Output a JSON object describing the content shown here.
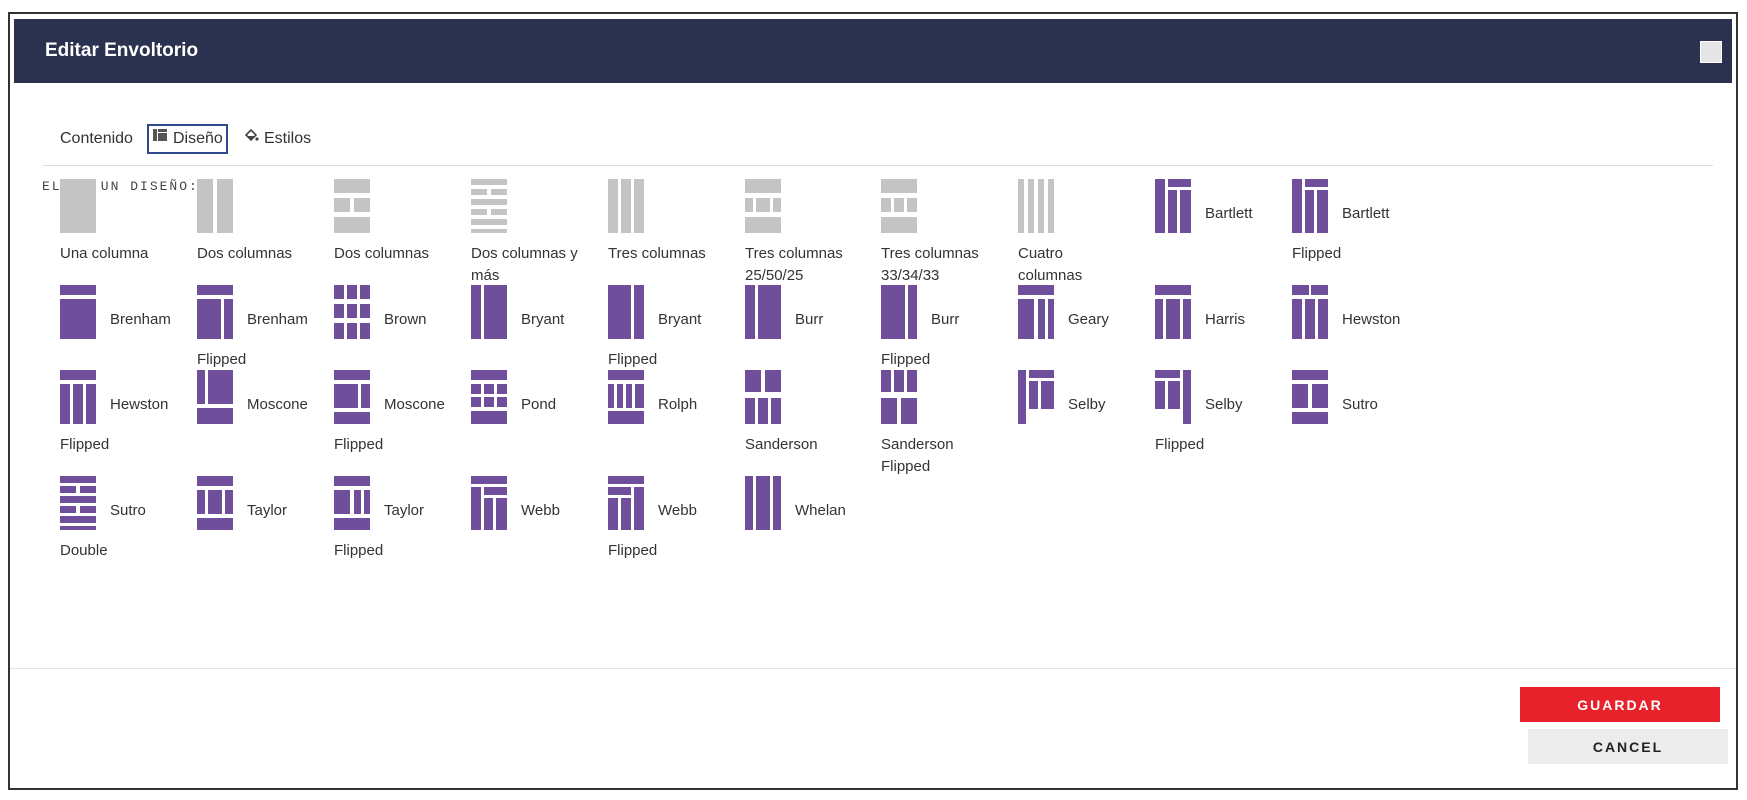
{
  "dialog": {
    "title": "Editar Envoltorio"
  },
  "tabs": [
    {
      "label": "Contenido"
    },
    {
      "label": "Diseño"
    },
    {
      "label": "Estilos"
    }
  ],
  "section_label": "ELIJA UN DISEÑO:",
  "layouts": [
    {
      "line1": "Una columna",
      "line2": "",
      "style": "gray",
      "shape": "one"
    },
    {
      "line1": "Dos columnas",
      "line2": "",
      "style": "gray",
      "shape": "two"
    },
    {
      "line1": "Dos columnas",
      "line2": "",
      "style": "gray",
      "shape": "two-rows"
    },
    {
      "line1": "Dos columnas y",
      "line2": "más",
      "style": "gray",
      "shape": "two-more"
    },
    {
      "line1": "Tres columnas",
      "line2": "",
      "style": "gray",
      "shape": "three"
    },
    {
      "line1": "Tres columnas",
      "line2": "25/50/25",
      "style": "gray",
      "shape": "three-255025"
    },
    {
      "line1": "Tres columnas",
      "line2": "33/34/33",
      "style": "gray",
      "shape": "three-333433"
    },
    {
      "line1": "Cuatro",
      "line2": "columnas",
      "style": "gray",
      "shape": "four"
    },
    {
      "line1": "Bartlett",
      "line2": "",
      "style": "purple",
      "shape": "bartlett"
    },
    {
      "line1": "Bartlett",
      "line2": "Flipped",
      "style": "purple",
      "shape": "bartlett-f"
    },
    {
      "line1": "Brenham",
      "line2": "",
      "style": "purple",
      "shape": "brenham"
    },
    {
      "line1": "Brenham",
      "line2": "Flipped",
      "style": "purple",
      "shape": "brenham-f"
    },
    {
      "line1": "Brown",
      "line2": "",
      "style": "purple",
      "shape": "brown"
    },
    {
      "line1": "Bryant",
      "line2": "",
      "style": "purple",
      "shape": "bryant"
    },
    {
      "line1": "Bryant",
      "line2": "Flipped",
      "style": "purple",
      "shape": "bryant-f"
    },
    {
      "line1": "Burr",
      "line2": "",
      "style": "purple",
      "shape": "burr"
    },
    {
      "line1": "Burr",
      "line2": "Flipped",
      "style": "purple",
      "shape": "burr-f"
    },
    {
      "line1": "Geary",
      "line2": "",
      "style": "purple",
      "shape": "geary"
    },
    {
      "line1": "Harris",
      "line2": "",
      "style": "purple",
      "shape": "harris"
    },
    {
      "line1": "Hewston",
      "line2": "",
      "style": "purple",
      "shape": "hewston"
    },
    {
      "line1": "Hewston",
      "line2": "Flipped",
      "style": "purple",
      "shape": "hewston-f"
    },
    {
      "line1": "Moscone",
      "line2": "",
      "style": "purple",
      "shape": "moscone"
    },
    {
      "line1": "Moscone",
      "line2": "Flipped",
      "style": "purple",
      "shape": "moscone-f"
    },
    {
      "line1": "Pond",
      "line2": "",
      "style": "purple",
      "shape": "pond"
    },
    {
      "line1": "Rolph",
      "line2": "",
      "style": "purple",
      "shape": "rolph"
    },
    {
      "line1": "",
      "line2": "Sanderson",
      "style": "purple",
      "shape": "sanderson"
    },
    {
      "line1": "",
      "line2": "Sanderson",
      "line3": "Flipped",
      "style": "purple",
      "shape": "sanderson-f"
    },
    {
      "line1": "Selby",
      "line2": "",
      "style": "purple",
      "shape": "selby"
    },
    {
      "line1": "Selby",
      "line2": "Flipped",
      "style": "purple",
      "shape": "selby-f"
    },
    {
      "line1": "Sutro",
      "line2": "",
      "style": "purple",
      "shape": "sutro"
    },
    {
      "line1": "Sutro",
      "line2": "Double",
      "style": "purple",
      "shape": "sutro-double"
    },
    {
      "line1": "Taylor",
      "line2": "",
      "style": "purple",
      "shape": "taylor"
    },
    {
      "line1": "Taylor",
      "line2": "Flipped",
      "style": "purple",
      "shape": "taylor-f"
    },
    {
      "line1": "Webb",
      "line2": "",
      "style": "purple",
      "shape": "webb"
    },
    {
      "line1": "Webb",
      "line2": "Flipped",
      "style": "purple",
      "shape": "webb-f"
    },
    {
      "line1": "Whelan",
      "line2": "",
      "style": "purple",
      "shape": "whelan"
    }
  ],
  "buttons": {
    "save": "GUARDAR",
    "cancel": "CANCEL"
  },
  "colors": {
    "header": "#2b3250",
    "purple": "#6f4e9c",
    "gray": "#c4c4c4",
    "save": "#e8222b"
  }
}
